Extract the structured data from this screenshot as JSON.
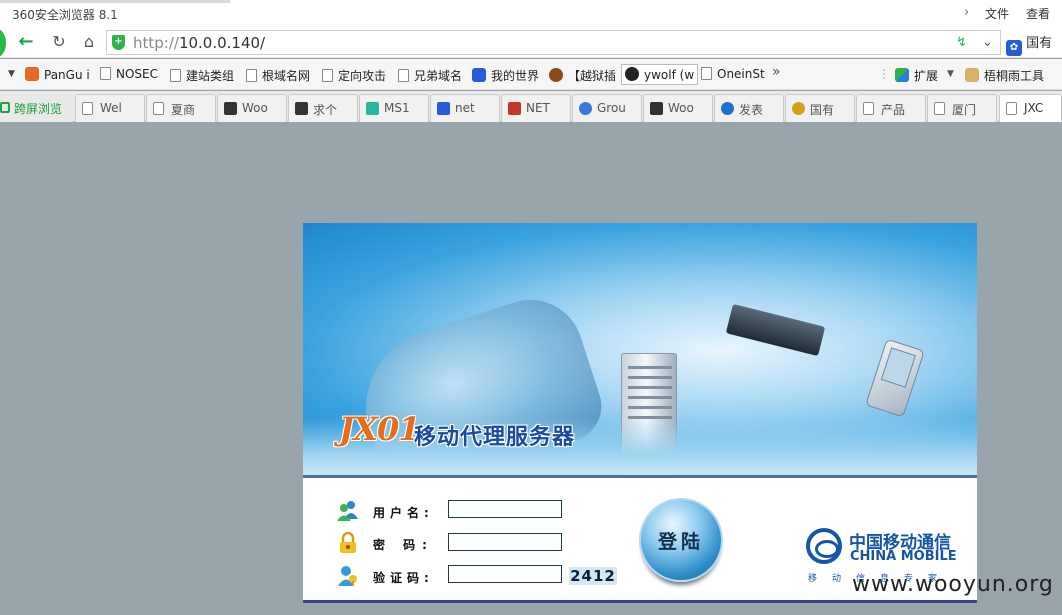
{
  "window": {
    "title": "360安全浏览器 8.1",
    "menu": [
      "文件",
      "查看"
    ]
  },
  "address_bar": {
    "url_protocol": "http://",
    "url_host": "10.0.0.140/",
    "search_engine_label": "国有"
  },
  "bookmarks": [
    {
      "label": "PanGu i",
      "icon": "pangu-icon"
    },
    {
      "label": "NOSEC",
      "icon": "page-icon"
    },
    {
      "label": "建站类组",
      "icon": "page-icon"
    },
    {
      "label": "根域名网",
      "icon": "page-icon"
    },
    {
      "label": "定向攻击",
      "icon": "page-icon"
    },
    {
      "label": "兄弟域名",
      "icon": "page-icon"
    },
    {
      "label": "我的世界",
      "icon": "baidu-paw-icon"
    },
    {
      "label": "【越狱插",
      "icon": "monkey-icon"
    },
    {
      "label": "ywolf (w",
      "icon": "github-icon"
    },
    {
      "label": "OneinSt",
      "icon": "page-icon"
    }
  ],
  "bookmark_tools": {
    "more": "»",
    "extensions": "扩展",
    "user_tool": "梧桐雨工具"
  },
  "tabs": [
    {
      "label": "跨屏浏览",
      "icon": "cross-screen-icon"
    },
    {
      "label": "Wel",
      "icon": "page-icon"
    },
    {
      "label": "夏商",
      "icon": "page-icon"
    },
    {
      "label": "Woo",
      "icon": "wooyun-icon"
    },
    {
      "label": "求个",
      "icon": "wooyun-icon"
    },
    {
      "label": "MS1",
      "icon": "ms-icon"
    },
    {
      "label": "net",
      "icon": "baidu-paw-icon"
    },
    {
      "label": "NET",
      "icon": "b-icon"
    },
    {
      "label": "Grou",
      "icon": "group-icon"
    },
    {
      "label": "Woo",
      "icon": "wooyun-icon"
    },
    {
      "label": "发表",
      "icon": "s-icon"
    },
    {
      "label": "国有",
      "icon": "emblem-icon"
    },
    {
      "label": "产品",
      "icon": "page-icon"
    },
    {
      "label": "厦门",
      "icon": "page-icon"
    },
    {
      "label": "JXC",
      "icon": "page-icon"
    }
  ],
  "login": {
    "brand_logo_text": "JX01",
    "product_name": "移动代理服务器",
    "username_label": "用户名:",
    "password_label": "密 码:",
    "captcha_label": "验证码:",
    "captcha_code": "2412",
    "login_button": "登陆",
    "username_value": "",
    "password_value": "",
    "captcha_value": ""
  },
  "china_mobile": {
    "name_cn": "中国移动通信",
    "name_en": "CHINA MOBILE",
    "slogan": "移动信息专家"
  },
  "watermark": "www.wooyun.org"
}
